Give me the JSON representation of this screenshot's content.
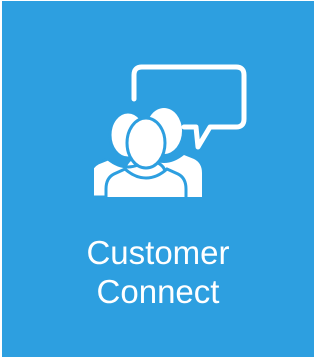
{
  "tile": {
    "icon": "customer-group-speech-bubble-icon",
    "label_line1": "Customer",
    "label_line2": "Connect",
    "background_color": "#2d9fe0",
    "foreground_color": "#ffffff"
  }
}
